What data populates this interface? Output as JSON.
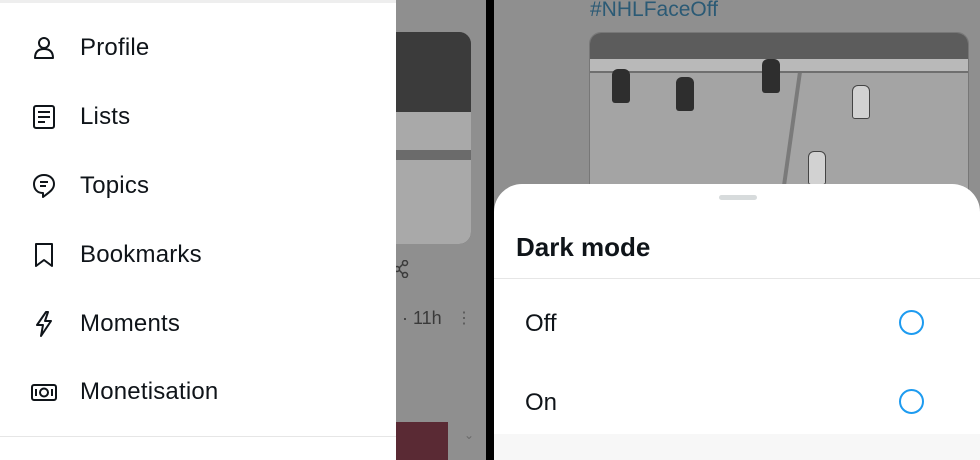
{
  "drawer": {
    "items": [
      {
        "label": "Profile",
        "icon": "person-icon"
      },
      {
        "label": "Lists",
        "icon": "list-icon"
      },
      {
        "label": "Topics",
        "icon": "topics-icon"
      },
      {
        "label": "Bookmarks",
        "icon": "bookmark-icon"
      },
      {
        "label": "Moments",
        "icon": "lightning-icon"
      },
      {
        "label": "Monetisation",
        "icon": "money-icon"
      }
    ]
  },
  "left_background": {
    "timestamp": "· 11h"
  },
  "right_background": {
    "hashtag": "#NHLFaceOff"
  },
  "dark_mode_sheet": {
    "title": "Dark mode",
    "options": [
      {
        "label": "Off",
        "selected": false
      },
      {
        "label": "On",
        "selected": false
      }
    ]
  },
  "colors": {
    "accent": "#1d9bf0",
    "text": "#0f1419"
  }
}
